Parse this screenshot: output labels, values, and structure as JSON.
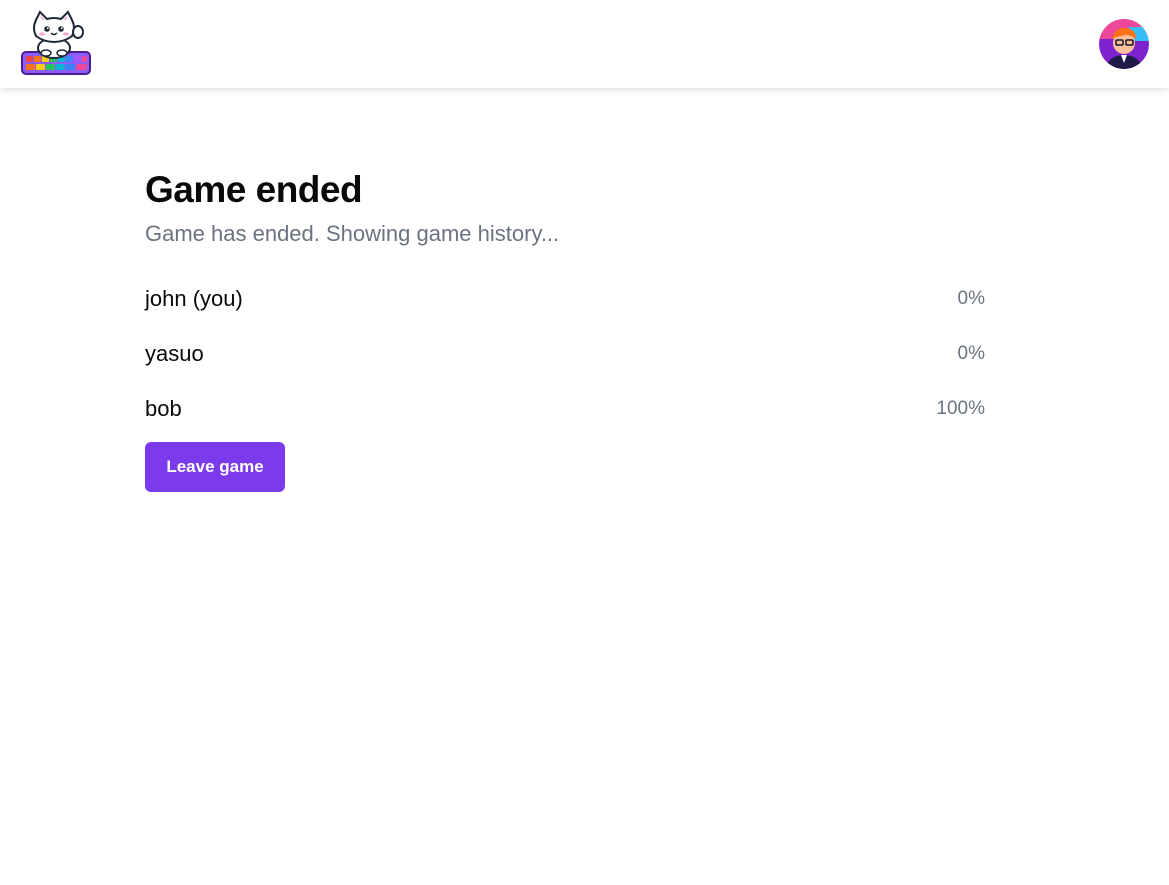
{
  "header": {
    "logo_icon": "cat-keyboard-logo-icon",
    "avatar_icon": "user-avatar-icon"
  },
  "main": {
    "title": "Game ended",
    "subtitle": "Game has ended. Showing game history...",
    "players": [
      {
        "name": "john (you)",
        "progress": "0%"
      },
      {
        "name": "yasuo",
        "progress": "0%"
      },
      {
        "name": "bob",
        "progress": "100%"
      }
    ],
    "leave_label": "Leave game"
  },
  "colors": {
    "accent": "#7c3aed",
    "muted_text": "#6b7280",
    "text": "#0a0a0a"
  }
}
